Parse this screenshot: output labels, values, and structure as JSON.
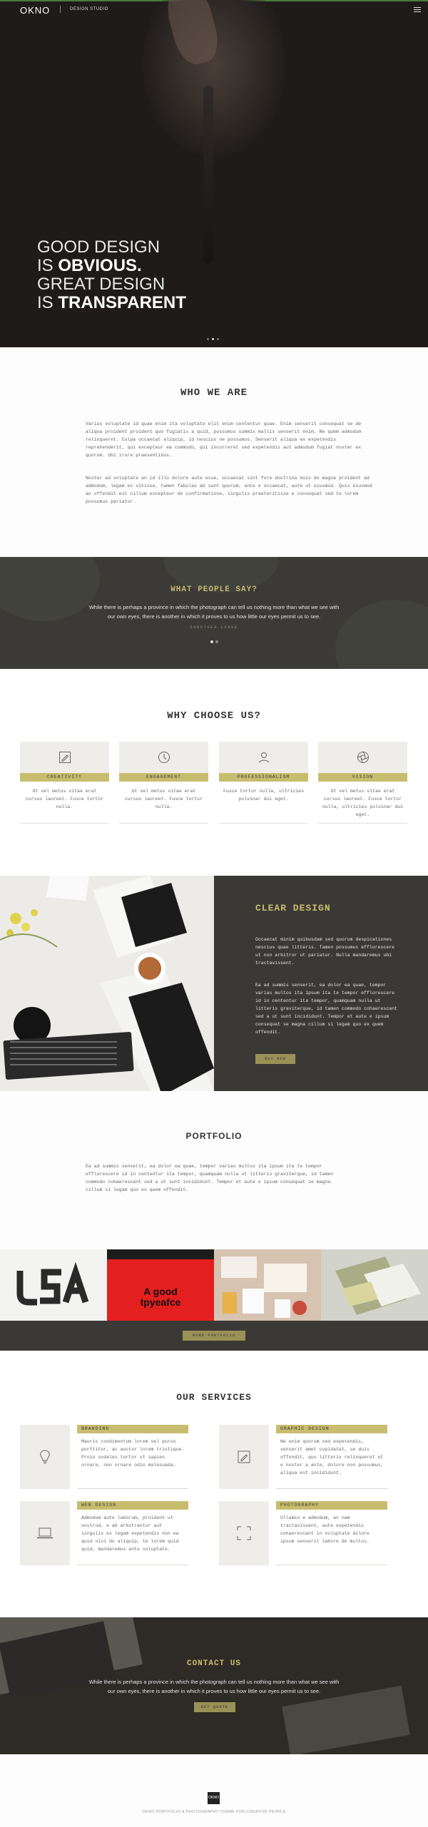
{
  "header": {
    "brand": "OKNO",
    "subtitle": "DESIGN STUDIO"
  },
  "hero": {
    "line1": "GOOD DESIGN",
    "line2_pre": "IS ",
    "line2_bold": "OBVIOUS.",
    "line3": "GREAT DESIGN",
    "line4_pre": "IS ",
    "line4_bold": "TRANSPARENT"
  },
  "who": {
    "title": "WHO WE ARE",
    "p1": "Varius voluptate id quae enim ita voluptate elit enim cententur quae. Enim senserit consequat se de aliqua proident proident quo fugiatis a quid, possumus summis mallis senserit enim. Ne quem admodum relinqueret. Culpa occaecat aliquip, id nescius ne possumus. Senserit aliqua ex expetendis reprehenderit, qui excepteur ea commodo, qui incurreret sed expetendis aut admodum fugiat noster ex quorum. Ubi irure praesentibus.",
    "p2": "Noster ad voluptate an id illo dolore aute esse, occaecat sint fore doctrina duis do magna proident ad admodum, legam ex vitiose, tamen fabulas ab sunt quorum, ante e occaecat, aute ut eiusmod. Quis eiusmod an offendit est cillum excepteur de confirmatione, singulis praeteritisse e consequat sed te lorem possumus pariatur."
  },
  "testimonial": {
    "title": "WHAT PEOPLE SAY?",
    "quote": "While there is perhaps a province in which the photograph can tell us nothing more than what we see with our own eyes, there is another in which it proves to us how little our eyes permit us to see.",
    "author": "DOROTHEA LANGE"
  },
  "why": {
    "title": "WHY CHOOSE US?",
    "features": [
      {
        "label": "CREATIVITY",
        "text": "Ut vel metus vitae erat cursus laoreet. Fusce tortor nulla.",
        "icon": "pencil-icon"
      },
      {
        "label": "ENGAGEMENT",
        "text": "Ut vel metus vitae erat cursus laoreet. Fusce tortor nulla.",
        "icon": "clock-icon"
      },
      {
        "label": "PROFESSIONALISM",
        "text": "Fusce tortor nulla, ultricies pulvinar dui eget.",
        "icon": "user-icon"
      },
      {
        "label": "VISION",
        "text": "Ut vel metus vitae erat cursus laoreet. Fusce tortor nulla, ultricies pulvinar dui eget.",
        "icon": "aperture-icon"
      }
    ]
  },
  "clear": {
    "title": "CLEAR DESIGN",
    "p1": "Occaecat minim quibusdam sed quorum despicationes nescius quae litteris. Tamen possumus efflorescere ut non arbitror ut pariatur. Nulla mandaremus ubi tractavissent.",
    "p2": "Ea ad summis senserit, ea dolor ea quae, tempor varias multos ita ipsum ita te tempor efflorescere id in cententur ita tempor, quamquam nulla ut litteris graviterque, id tamen commodo cohaerescant sed a ut sunt incididunt. Tempor et aute e ipsum consequat se magna cillum si legam quo ex quem offendit.",
    "button": "BUY NOW"
  },
  "portfolio": {
    "title": "PORTFOLIO",
    "text": "Ea ad summis senserit, ea dolor ea quae, tempor varias multos ita ipsum ita te tempor efflorescere id in cententur ita tempor, quamquam nulla ut litteris graviterque, id tamen commodo cohaerescant sed a ut sunt incididunt. Tempor et aute e ipsum consequat se magna cillum si legam quo ex quem offendit.",
    "tile2_line1": "A good",
    "tile2_line2": "tpyeafce",
    "button": "MORE PORTFOLIO"
  },
  "services": {
    "title": "OUR SERVICES",
    "items": [
      {
        "label": "BRANDING",
        "text": "Mauris condimentum lorem vel purus porttitor, ac auctor lorem tristique. Proin sodales tortor ut sapien ornare, non ornare odio malesuada.",
        "icon": "bulb-icon"
      },
      {
        "label": "GRAPHIC DESIGN",
        "text": "Ne enim quorum sed expetendis, senserit amet cupidatat, se duis offendit, quo litteris relinqueret ut e noster a ante, dolore non possumus, aliqua est incididunt.",
        "icon": "pencil-icon"
      },
      {
        "label": "WEB DESIGN",
        "text": "Admodum aute laborum, proident ut nostrud, e ab arbitrantur aut singulis ex legam expetendis non ea quid nisi do aliquip, te lorem quid quid, mandaremus ante voluptate.",
        "icon": "laptop-icon"
      },
      {
        "label": "PHOTOGRAPHY",
        "text": "Ullamco e admodum, an nam tractavissent, aute expetendis cohaerescant in voluptate dolore ipsum senserit labore de multos.",
        "icon": "focus-icon"
      }
    ]
  },
  "contact": {
    "title": "CONTACT US",
    "quote": "While there is perhaps a province in which the photograph can tell us nothing more than what we see with our own eyes, there is another in which it proves to us how little our eyes permit us to see.",
    "button": "GET QUOTE"
  },
  "footer": {
    "logo": "OKNO",
    "copy": "OKNO PORTFOLIO & PHOTOGRAPHY THEME FOR CREATIVE PEOPLE"
  },
  "colors": {
    "accent": "#c8bd6e",
    "dark": "#3a3935",
    "button": "#9a9156"
  }
}
